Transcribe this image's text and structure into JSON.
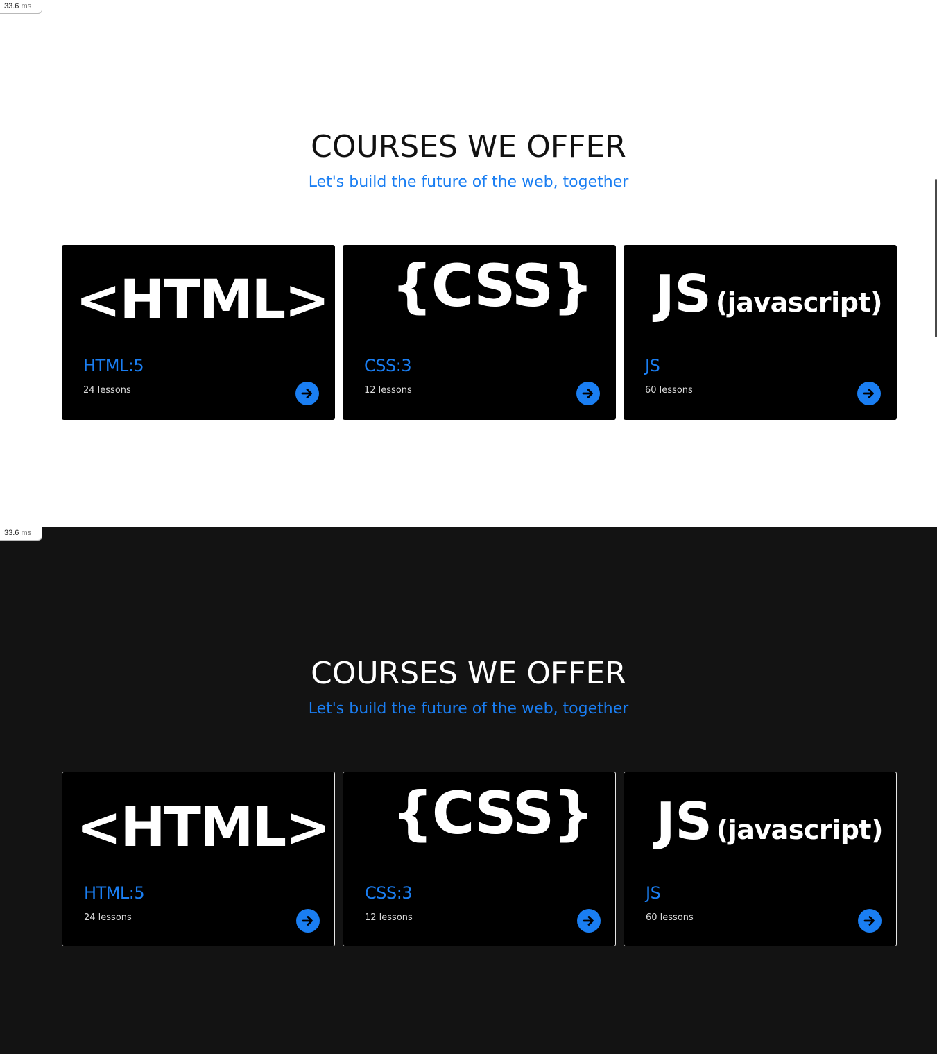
{
  "perf": {
    "value": "33.6",
    "unit": "ms"
  },
  "section": {
    "title": "COURSES WE OFFER",
    "subtitle": "Let's build the future of the web, together"
  },
  "courses": [
    {
      "logo": "<HTML>",
      "title": "HTML:5",
      "lessons": "24 lessons"
    },
    {
      "logo": "{CSS}",
      "title": "CSS:3",
      "lessons": "12 lessons"
    },
    {
      "logo_main": "JS",
      "logo_sub": "(javascript)",
      "title": "JS",
      "lessons": "60 lessons"
    }
  ],
  "themes": [
    "light",
    "dark"
  ],
  "colors": {
    "accent": "#1a7ef2",
    "card": "#000000",
    "dark_bg": "#131313"
  },
  "icons": {
    "card_action": "arrow-right-icon"
  }
}
